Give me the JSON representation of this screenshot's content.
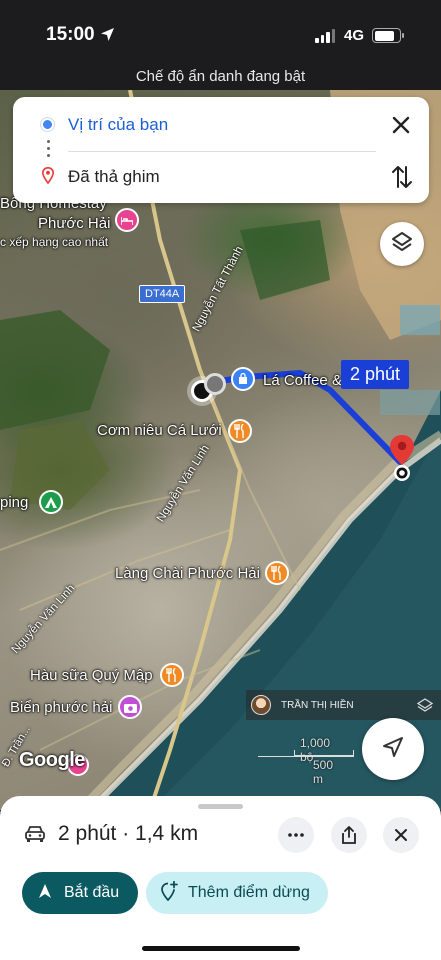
{
  "status_bar": {
    "time": "15:00",
    "network": "4G"
  },
  "incognito_notice": "Chế độ ẩn danh đang bật",
  "directions": {
    "origin": "Vị trí của bạn",
    "destination": "Đã thả ghim"
  },
  "map": {
    "route_duration_label": "2 phút",
    "road_dt44a": "DT44A",
    "road_nguyen_tat_thanh": "Nguyễn Tất Thành",
    "road_nguyen_van_linh_1": "Nguyễn Văn Linh",
    "road_nguyen_van_linh_2": "Nguyễn Văn Linh",
    "road_bottom": "Đ. Trần...",
    "places": {
      "homestay_line1": "Bông Homestay",
      "homestay_line2": "Phước Hải",
      "homestay_sub": "c xếp hạng cao nhất",
      "la_coffee": "Lá Coffee &",
      "com_nieu": "Cơm niêu Cá Lưới",
      "camping": "ping",
      "lang_chai": "Làng Chài Phước Hải",
      "hau_sua": "Hàu sữa Quý Mập",
      "bien": "Biển phước hải"
    },
    "contributor_name": "TRẦN THỊ HIỀN",
    "scale_imperial": "1,000 bộ",
    "scale_metric": "500 m",
    "logo_text": "Google"
  },
  "route_summary": "2 phút · 1,4 km",
  "actions": {
    "start_label": "Bắt đầu",
    "add_stop_label": "Thêm điểm dừng"
  },
  "colors": {
    "route": "#1a3fd6",
    "start_button": "#0b5a62",
    "add_stop_button": "#c8f0f4",
    "origin_dot": "#4285f4",
    "pin": "#e53935"
  }
}
